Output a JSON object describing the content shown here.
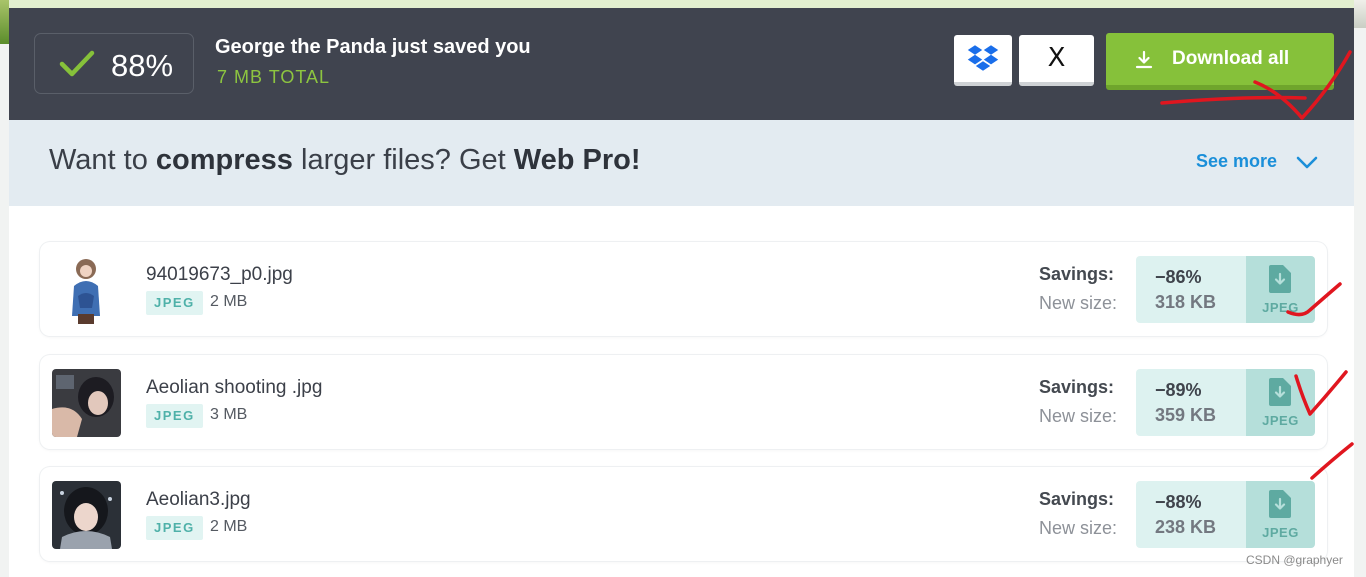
{
  "header": {
    "percent": "88%",
    "saved_title": "George the Panda just saved you",
    "total": "7 MB TOTAL",
    "share_dropbox_icon": "dropbox-icon",
    "share_x_label": "X",
    "download_all_label": "Download all"
  },
  "promo": {
    "prefix": "Want to ",
    "bold1": "compress",
    "middle": " larger files? Get ",
    "bold2": "Web Pro!",
    "see_more_label": "See more"
  },
  "files": [
    {
      "name": "94019673_p0.jpg",
      "type": "JPEG",
      "size": "2 MB",
      "savings_label": "Savings:",
      "newsize_label": "New size:",
      "change": "−86%",
      "new_size": "318 KB",
      "download_label": "JPEG"
    },
    {
      "name": "Aeolian shooting .jpg",
      "type": "JPEG",
      "size": "3 MB",
      "savings_label": "Savings:",
      "newsize_label": "New size:",
      "change": "−89%",
      "new_size": "359 KB",
      "download_label": "JPEG"
    },
    {
      "name": "Aeolian3.jpg",
      "type": "JPEG",
      "size": "2 MB",
      "savings_label": "Savings:",
      "newsize_label": "New size:",
      "change": "−88%",
      "new_size": "238 KB",
      "download_label": "JPEG"
    }
  ],
  "colors": {
    "header_bg": "#40444f",
    "accent_green": "#86c13a",
    "link_blue": "#1b8fd9",
    "badge_teal": "#4fb1a9",
    "annotation_red": "#e0161f"
  },
  "watermark": "CSDN @graphyer"
}
